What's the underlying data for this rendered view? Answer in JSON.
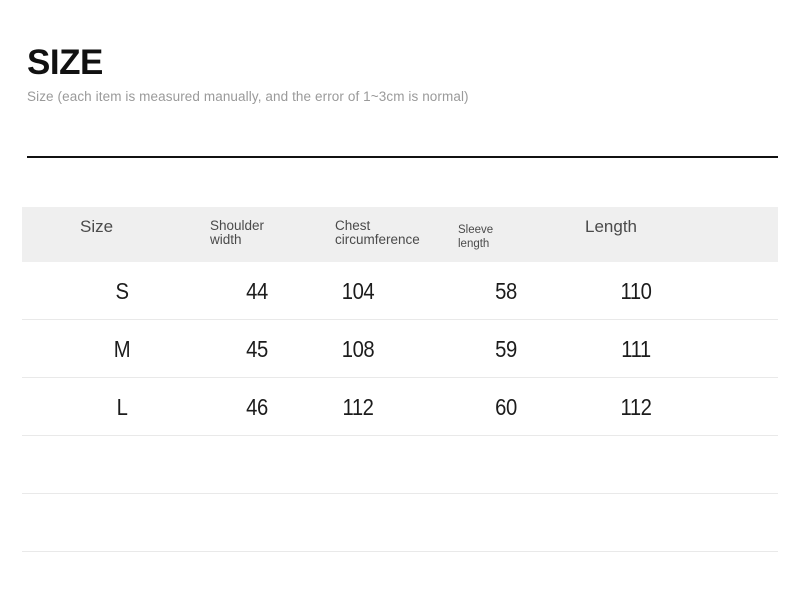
{
  "header": {
    "title": "SIZE",
    "subtitle": "Size (each item is measured manually, and the error of 1~3cm is normal)"
  },
  "table": {
    "columns": [
      {
        "label": "Size",
        "ghost": "· ·   ·"
      },
      {
        "label": "Shoulder\nwidth",
        "ghost": ""
      },
      {
        "label": "Chest\ncircumference",
        "ghost": ""
      },
      {
        "label": "Sleeve\nlength",
        "ghost": "· · · ·"
      },
      {
        "label": "Length",
        "ghost": "·   ·"
      }
    ],
    "rows": [
      {
        "size": "S",
        "shoulder_width": "44",
        "chest_circumference": "104",
        "sleeve_length": "58",
        "length": "110"
      },
      {
        "size": "M",
        "shoulder_width": "45",
        "chest_circumference": "108",
        "sleeve_length": "59",
        "length": "111"
      },
      {
        "size": "L",
        "shoulder_width": "46",
        "chest_circumference": "112",
        "sleeve_length": "60",
        "length": "112"
      },
      {
        "size": "",
        "shoulder_width": "",
        "chest_circumference": "",
        "sleeve_length": "",
        "length": ""
      },
      {
        "size": "",
        "shoulder_width": "",
        "chest_circumference": "",
        "sleeve_length": "",
        "length": ""
      }
    ]
  },
  "colors": {
    "rule": "#111111",
    "header_band": "#efefef",
    "divider": "#e9e9e9",
    "title_text": "#111111",
    "subtitle_text": "#9a9a9a",
    "header_text": "#4a4a4a",
    "cell_text": "#1c1c1c"
  }
}
